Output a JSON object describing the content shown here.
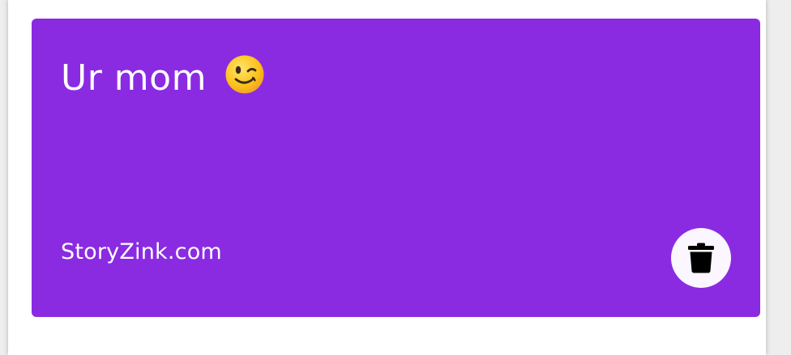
{
  "card": {
    "quote_text": "Ur mom",
    "emoji": "winking-face",
    "brand_text": "StoryZink.com",
    "background_color": "#8a2be2",
    "text_color": "#ffffff"
  },
  "actions": {
    "delete_icon": "trash-icon",
    "delete_button_color": "#fbf6ff"
  }
}
